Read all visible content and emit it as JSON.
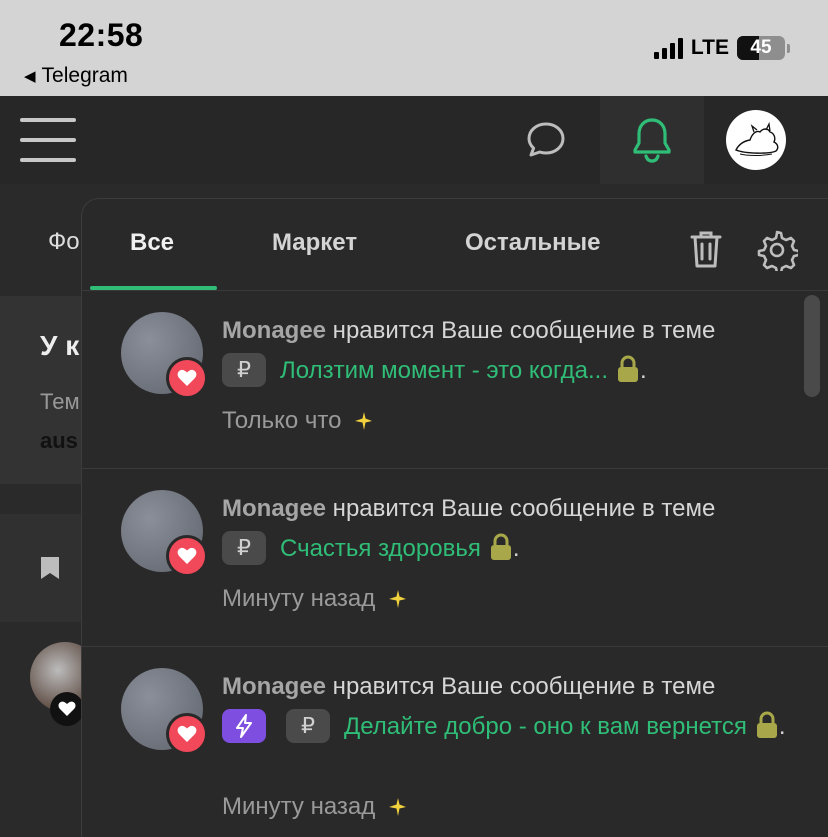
{
  "status_bar": {
    "time": "22:58",
    "back_label": "Telegram",
    "network": "LTE",
    "battery_level": "45",
    "battery_fraction": 0.45
  },
  "background_page": {
    "tab_partial": "Фо",
    "card_title_partial": "У к",
    "card_sub_partial": "Тем",
    "card_sub2_partial": "aus"
  },
  "dropdown": {
    "tabs": [
      {
        "label": "Все",
        "active": true
      },
      {
        "label": "Маркет",
        "active": false
      },
      {
        "label": "Остальные",
        "active": false
      }
    ],
    "accent_color": "#2fbd77",
    "notifications": [
      {
        "user": "Monagee",
        "action": " нравится Ваше сообщение в теме",
        "badge_ruble": "₽",
        "topic": "Лолзтим момент - это когда...",
        "time": "Только что"
      },
      {
        "user": "Monagee",
        "action": " нравится Ваше сообщение в теме",
        "badge_ruble": "₽",
        "topic": "Счастья здоровья",
        "time": "Минуту назад"
      },
      {
        "user": "Monagee",
        "action": " нравится Ваше сообщение в теме",
        "badge_ruble": "₽",
        "topic": "Делайте добро - оно к вам вернется",
        "time": "Минуту назад"
      }
    ],
    "suffix": "."
  },
  "icons": {
    "menu": "hamburger-menu-icon",
    "chat": "chat-bubble-icon",
    "bell": "bell-icon",
    "trash": "trash-icon",
    "gear": "gear-icon",
    "heart": "heart-icon",
    "lock": "lock-icon",
    "sparkle": "sparkle-icon",
    "bolt": "lightning-icon",
    "bookmark": "bookmark-icon"
  }
}
